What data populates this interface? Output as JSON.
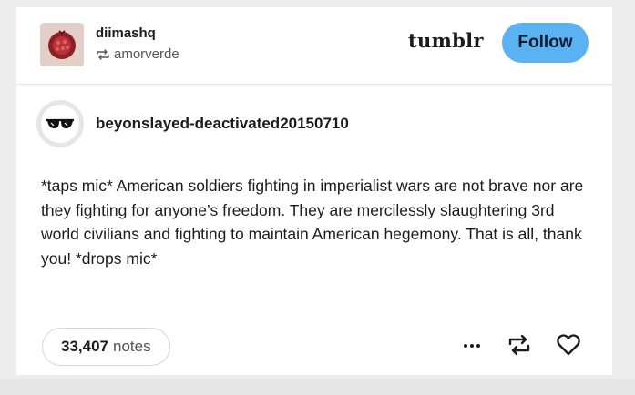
{
  "header": {
    "reblogger_name": "diimashq",
    "source_name": "amorverde",
    "logo_text": "tumblr",
    "follow_label": "Follow"
  },
  "post": {
    "author_name": "beyonslayed-deactivated20150710",
    "body": "*taps mic* American soldiers fighting in imperialist wars are not brave nor are they fighting for anyone’s freedom. They are mercilessly slaughtering 3rd world civilians and fighting to maintain American hegemony. That is all, thank you! *drops mic*"
  },
  "footer": {
    "notes_count": "33,407",
    "notes_label": "notes",
    "more_icon": "ellipsis-icon",
    "reblog_icon": "reblog-icon",
    "like_icon": "heart-icon"
  },
  "colors": {
    "follow_button": "#5ab2f3",
    "text": "#1b1b1b",
    "muted_text": "#555555"
  }
}
